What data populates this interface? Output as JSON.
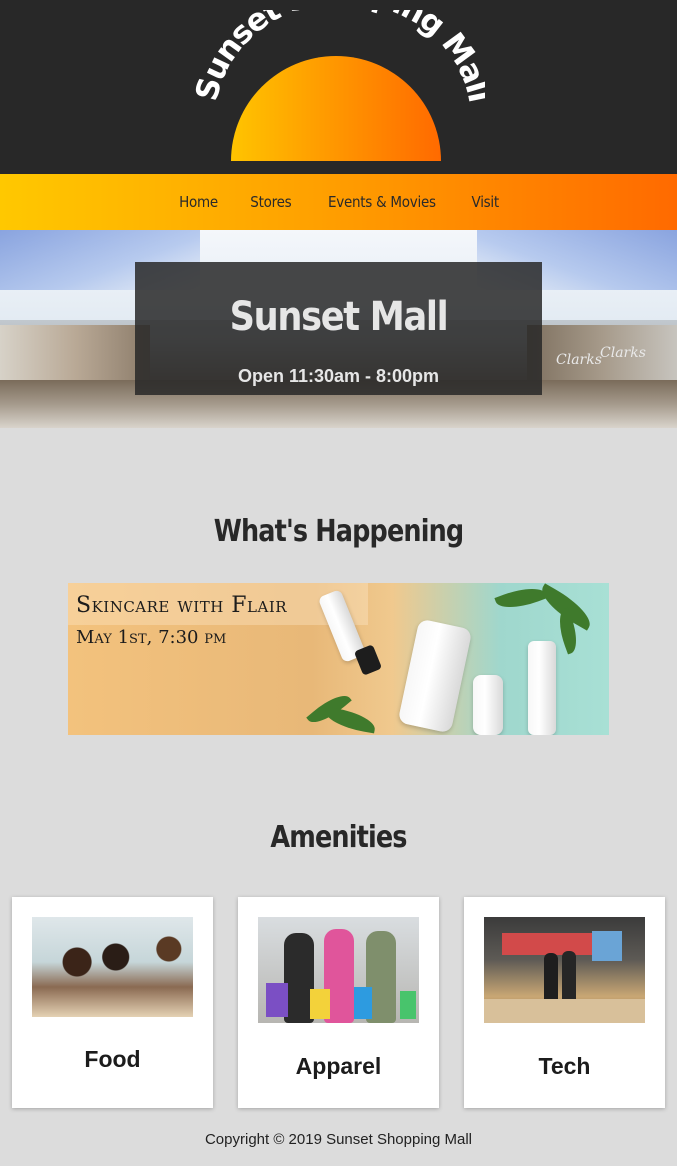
{
  "header": {
    "logo_text": "Sunset Shopping Mall",
    "brand_gradient": [
      "#ffc400",
      "#ff9f00",
      "#ff6a00"
    ],
    "background_color": "#282828"
  },
  "nav": {
    "items": [
      {
        "label": "Home"
      },
      {
        "label": "Stores"
      },
      {
        "label": "Events & Movies"
      },
      {
        "label": "Visit"
      }
    ]
  },
  "hero": {
    "title": "Sunset Mall",
    "hours": "Open 11:30am - 8:00pm",
    "store_signs": [
      "Clarks",
      "Clarks"
    ]
  },
  "happening": {
    "heading": "What's Happening",
    "event": {
      "title": "Skincare with Flair",
      "date": "May 1st, 7:30 pm"
    }
  },
  "amenities": {
    "heading": "Amenities",
    "cards": [
      {
        "label": "Food",
        "image": "friends-eating-photo"
      },
      {
        "label": "Apparel",
        "image": "shoppers-with-bags-photo"
      },
      {
        "label": "Tech",
        "image": "tech-store-photo"
      }
    ]
  },
  "footer": {
    "copyright": "Copyright © 2019 Sunset Shopping Mall"
  }
}
